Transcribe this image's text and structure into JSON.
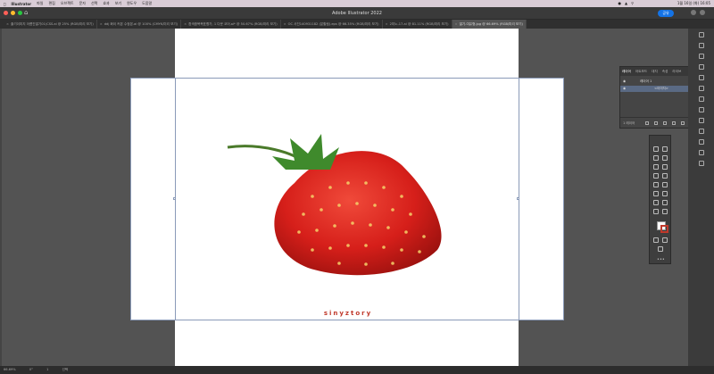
{
  "menubar": {
    "app": "Illustrator",
    "items": [
      "파일",
      "편집",
      "오브젝트",
      "문자",
      "선택",
      "효과",
      "보기",
      "윈도우",
      "도움말"
    ],
    "clock": "1월 16일 (화)  16:05"
  },
  "window": {
    "title": "Adobe Illustrator 2022",
    "share_label": "공유"
  },
  "tabs": [
    {
      "label": "출기이미지 아름진딸기01(CSS.ai @ 25% (RGB/미리 보기)"
    },
    {
      "label": "ddj 화이 커본 수정본.ai @ 100% (CMYK/미리 보기)"
    },
    {
      "label": "흰색중복목표향가, 1 다운 코어.ai* @ 50.67% (RGB/미리 보기)"
    },
    {
      "label": "OC 사진140931182 (분할됨).eps @ 66.35% (RGB/미리 보기)"
    },
    {
      "label": "2미노-17.ai @ 81.11% (RGB/미리 보기)"
    },
    {
      "label": "딸기-여유형.jpg @ 66.69% (RGB/미리 보기)",
      "active": true
    }
  ],
  "canvas": {
    "brand_text": "sinyztory",
    "image": "strawberry"
  },
  "layers_panel": {
    "tabs": [
      "레이어",
      "아트보드",
      "대지",
      "속성",
      "라이브"
    ],
    "active_tab": "레이어",
    "rows": [
      {
        "label": "레이어 1"
      },
      {
        "label": "<이미지>"
      }
    ],
    "footer": "1 레이어"
  },
  "statusbar": {
    "zoom": "66.69%",
    "rotation": "0°",
    "artboard": "1",
    "tool": "선택"
  },
  "colors": {
    "accent": "#1473e6",
    "brand_red": "#c0392b",
    "canvas_bg": "#535353",
    "menubar_bg": "#d9ccd6"
  }
}
